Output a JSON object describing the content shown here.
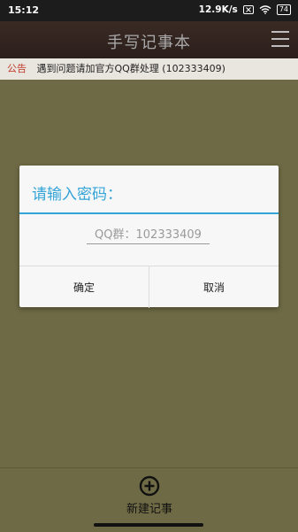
{
  "status_bar": {
    "time": "15:12",
    "network_speed": "12.9K/s",
    "battery": "74"
  },
  "header": {
    "title": "手写记事本"
  },
  "notice": {
    "label": "公告",
    "text": "遇到问题请加官方QQ群处理 (102333409)"
  },
  "dialog": {
    "title": "请输入密码：",
    "input_placeholder": "QQ群：102333409",
    "confirm_label": "确定",
    "cancel_label": "取消"
  },
  "bottom": {
    "new_note_label": "新建记事"
  },
  "colors": {
    "background": "#6e6a45",
    "title_bar": "#2b1f1b",
    "accent": "#33a4d8",
    "notice_label": "#c0392b"
  }
}
